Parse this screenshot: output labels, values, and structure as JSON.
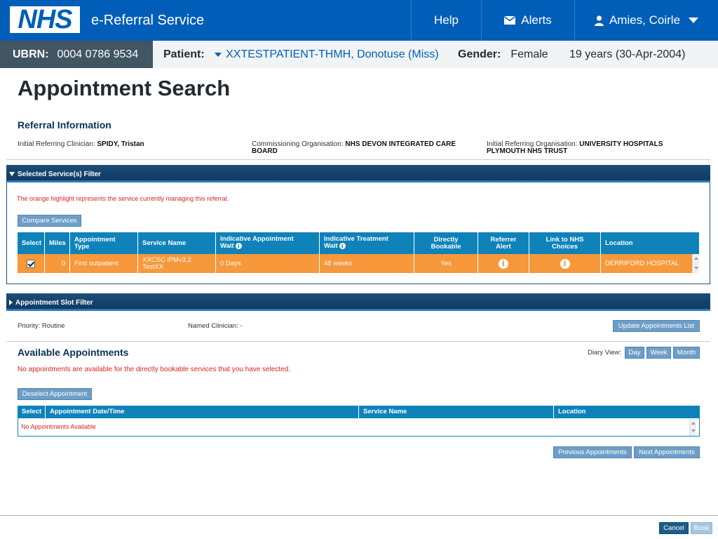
{
  "header": {
    "logo_text": "NHS",
    "service_name": "e-Referral Service",
    "help_label": "Help",
    "alerts_label": "Alerts",
    "user_name": "Amies, Coirle"
  },
  "patient_bar": {
    "ubrn_label": "UBRN:",
    "ubrn_value": "0004 0786 9534",
    "patient_label": "Patient:",
    "patient_name": "XXTESTPATIENT-THMH, Donotuse (Miss)",
    "gender_label": "Gender:",
    "gender_value": "Female",
    "age_dob": "19 years (30-Apr-2004)"
  },
  "page_title": "Appointment Search",
  "referral": {
    "title": "Referral Information",
    "clinician_label": "Initial Referring Clinician:",
    "clinician_value": "SPIDY, Tristan",
    "commissioning_label": "Commissioning Organisation:",
    "commissioning_value_1": "NHS DEVON INTEGRATED CARE",
    "commissioning_value_2": "BOARD",
    "referring_org_label": "Initial Referring Organisation:",
    "referring_org_value_1": "UNIVERSITY HOSPITALS",
    "referring_org_value_2": "PLYMOUTH NHS TRUST"
  },
  "service_filter": {
    "header": "Selected Service(s) Filter",
    "note": "The orange highlight represents the service currently managing this referral.",
    "compare_button": "Compare Services",
    "columns": {
      "select": "Select",
      "miles": "Miles",
      "appt_type_1": "Appointment",
      "appt_type_2": "Type",
      "service_name": "Service Name",
      "appt_wait_1": "Indicative Appointment",
      "appt_wait_2": "Wait",
      "treatment_wait_1": "Indicative Treatment",
      "treatment_wait_2": "Wait",
      "directly_1": "Directly",
      "directly_2": "Bookable",
      "referrer_1": "Referrer",
      "referrer_2": "Alert",
      "link_1": "Link to NHS",
      "link_2": "Choices",
      "location": "Location"
    },
    "row": {
      "miles": "0",
      "appt_type": "First outpatient",
      "service_name_1": "XXCSC iPMv3.2",
      "service_name_2": "TestXX",
      "appt_wait": "0 Days",
      "treatment_wait": "48 weeks",
      "directly_bookable": "Yes",
      "location": "DERRIFORD HOSPITAL"
    }
  },
  "slot_filter": {
    "header": "Appointment Slot Filter",
    "priority": "Priority: Routine",
    "named_clinician": "Named Clinician: -",
    "update_button": "Update Appointments List"
  },
  "available": {
    "title": "Available Appointments",
    "diary_view_label": "Diary View:",
    "day": "Day",
    "week": "Week",
    "month": "Month",
    "message": "No appointments are available for the directly bookable services that you have selected.",
    "deselect_button": "Deselect Appointment",
    "columns": {
      "select": "Select",
      "datetime": "Appointment Date/Time",
      "service_name": "Service Name",
      "location": "Location"
    },
    "empty_text": "No Appointments Available",
    "previous_button": "Previous Appointments",
    "next_button": "Next Appointments"
  },
  "footer": {
    "cancel": "Cancel",
    "book": "Book"
  },
  "colors": {
    "nhs_blue": "#005eb8",
    "highlight_orange": "#f7983a",
    "table_header": "#0f82ba",
    "error_red": "#d5281b"
  }
}
